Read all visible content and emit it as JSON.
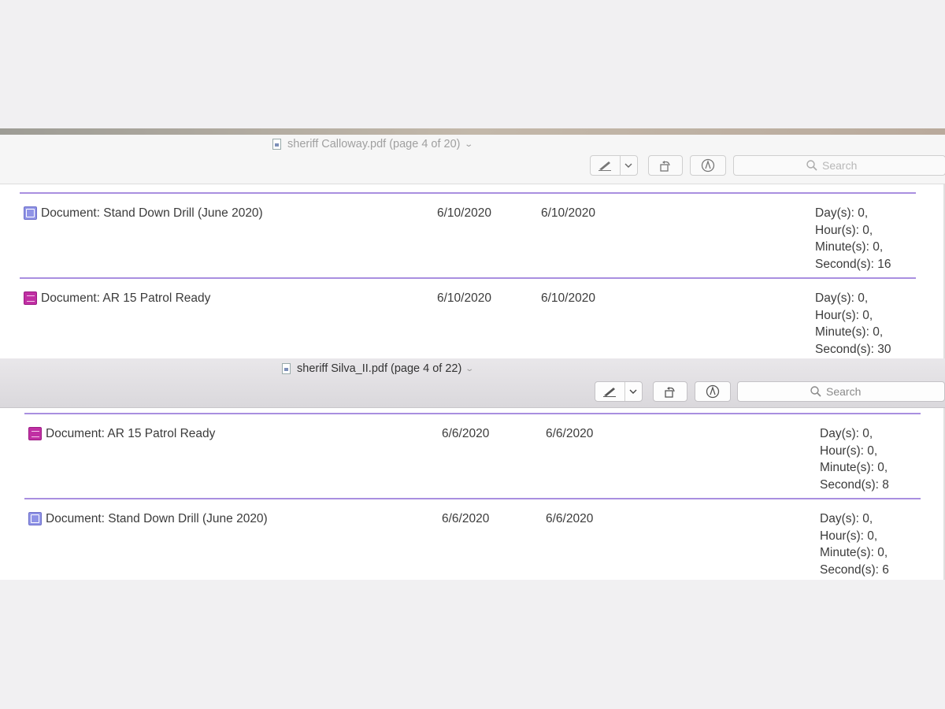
{
  "window1": {
    "title": "sheriff Calloway.pdf (page 4 of 20)",
    "toolbar": {
      "search_placeholder": "Search"
    },
    "rows": [
      {
        "name": "Document: Stand Down Drill (June 2020)",
        "icon": "blue-document-icon",
        "date1": "6/10/2020",
        "date2": "6/10/2020",
        "days": "Day(s): 0,",
        "hours": "Hour(s): 0,",
        "minutes": "Minute(s): 0,",
        "seconds": "Second(s): 16"
      },
      {
        "name": "Document: AR 15 Patrol Ready",
        "icon": "pink-document-icon",
        "date1": "6/10/2020",
        "date2": "6/10/2020",
        "days": "Day(s): 0,",
        "hours": "Hour(s): 0,",
        "minutes": "Minute(s): 0,",
        "seconds": "Second(s): 30"
      }
    ]
  },
  "window2": {
    "title": "sheriff Silva_II.pdf (page 4 of 22)",
    "toolbar": {
      "search_placeholder": "Search"
    },
    "rows": [
      {
        "name": "Document: AR 15 Patrol Ready",
        "icon": "pink-document-icon",
        "date1": "6/6/2020",
        "date2": "6/6/2020",
        "days": "Day(s): 0,",
        "hours": "Hour(s): 0,",
        "minutes": "Minute(s): 0,",
        "seconds": "Second(s): 8"
      },
      {
        "name": "Document: Stand Down Drill (June 2020)",
        "icon": "blue-document-icon",
        "date1": "6/6/2020",
        "date2": "6/6/2020",
        "days": "Day(s): 0,",
        "hours": "Hour(s): 0,",
        "minutes": "Minute(s): 0,",
        "seconds": "Second(s): 6"
      }
    ]
  },
  "colors": {
    "divider": "#a98fe0",
    "blue_icon": "#8f93e6",
    "pink_icon": "#c02fa3"
  }
}
